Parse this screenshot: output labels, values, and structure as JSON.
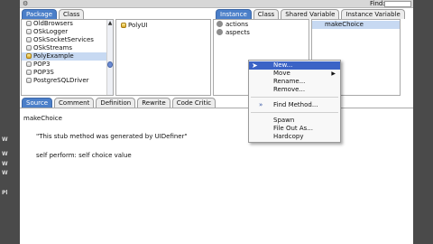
{
  "window": {
    "find_label": "Find:",
    "left_edge_marks": [
      "W",
      "W",
      "W",
      "W",
      "Pl"
    ]
  },
  "class_tabs": {
    "items": [
      {
        "label": "Package",
        "active": true
      },
      {
        "label": "Class",
        "active": false
      }
    ]
  },
  "package_list": {
    "items": [
      "OldBrowsers",
      "OSkLogger",
      "OSkSocketServices",
      "OSkStreams",
      "PolyExample",
      "POP3",
      "POP3S",
      "PostgreSQLDriver"
    ],
    "selected": "PolyExample"
  },
  "class_list": {
    "items": [
      "PolyUI"
    ]
  },
  "protocol_tabs": {
    "items": [
      {
        "label": "Instance",
        "active": true
      },
      {
        "label": "Class",
        "active": false
      },
      {
        "label": "Shared Variable",
        "active": false
      },
      {
        "label": "Instance Variable",
        "active": false
      }
    ]
  },
  "protocol_list": {
    "items": [
      "actions",
      "aspects"
    ]
  },
  "method_list": {
    "items": [
      "makeChoice"
    ]
  },
  "code_tabs": {
    "items": [
      {
        "label": "Source",
        "active": true
      },
      {
        "label": "Comment",
        "active": false
      },
      {
        "label": "Definition",
        "active": false
      },
      {
        "label": "Rewrite",
        "active": false
      },
      {
        "label": "Code Critic",
        "active": false
      }
    ]
  },
  "source_code": {
    "selector": "makeChoice",
    "comment": "\"This stub method was generated by UIDefiner\"",
    "body": "self perform: self choice value"
  },
  "context_menu": {
    "items": [
      {
        "label": "New...",
        "highlighted": true,
        "submenu": false
      },
      {
        "label": "Move",
        "highlighted": false,
        "submenu": true
      },
      {
        "label": "Rename...",
        "highlighted": false,
        "submenu": false
      },
      {
        "label": "Remove...",
        "highlighted": false,
        "submenu": false
      },
      {
        "label": "Find Method...",
        "highlighted": false,
        "submenu": false
      },
      {
        "label": "Spawn",
        "highlighted": false,
        "submenu": false
      },
      {
        "label": "File Out As...",
        "highlighted": false,
        "submenu": false
      },
      {
        "label": "Hardcopy",
        "highlighted": false,
        "submenu": false
      }
    ],
    "find_glyph": "»"
  },
  "colors": {
    "active_tab": "#4b7fc9",
    "menu_highlight": "#3b63c6",
    "selected_row": "#c7d9f2"
  }
}
